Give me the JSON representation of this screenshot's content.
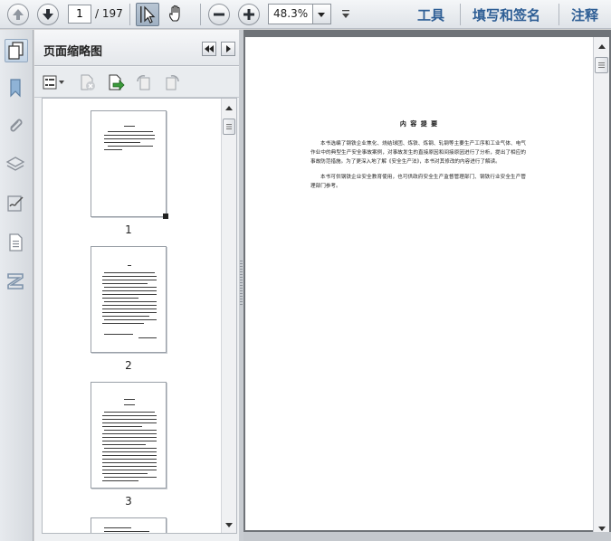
{
  "toolbar": {
    "page_current": "1",
    "page_total": "/ 197",
    "zoom": "48.3%",
    "menu": [
      "工具",
      "填写和签名",
      "注释"
    ]
  },
  "panel": {
    "title": "页面缩略图",
    "thumbnails": [
      {
        "label": "1"
      },
      {
        "label": "2"
      },
      {
        "label": "3"
      }
    ]
  },
  "document": {
    "title": "内 容 提 要",
    "paragraphs": [
      "本书选编了钢铁企业焦化、烧结球团、炼铁、炼钢、轧钢等主要生产工序和工业气体、电气作业中的典型生产安全事故案例，对事故发生的直接原因和间接原因进行了分析，提出了相应的事故防范措施。为了更深入地了解《安全生产法》，本书对其修改的内容进行了解读。",
      "本书可供钢铁企业安全教育使用，也可供政府安全生产监督管理部门、钢铁行业安全生产管理部门参考。"
    ]
  },
  "icons": {
    "toolbar": [
      "arrow-up-icon",
      "arrow-down-icon",
      "select-cursor-icon",
      "hand-icon",
      "zoom-out-icon",
      "zoom-in-icon",
      "chevron-down-icon"
    ],
    "sidebar": [
      "pages-icon",
      "bookmark-icon",
      "attachment-icon",
      "layers-icon",
      "signature-icon",
      "content-icon",
      "tags-icon"
    ]
  }
}
